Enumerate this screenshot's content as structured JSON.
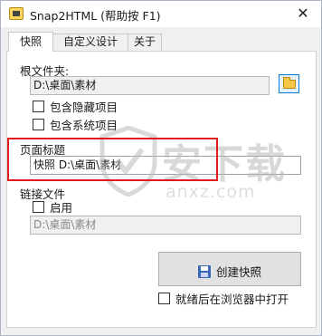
{
  "window": {
    "title": "Snap2HTML (帮助按 F1)",
    "close_glyph": "✕"
  },
  "tabs": [
    {
      "label": "快照",
      "active": true
    },
    {
      "label": "自定义设计",
      "active": false
    },
    {
      "label": "关于",
      "active": false
    }
  ],
  "root_folder": {
    "label": "根文件夹:",
    "value": "D:\\桌面\\素材",
    "browse_icon": "folder-icon"
  },
  "options": {
    "include_hidden": {
      "label": "包含隐藏项目",
      "checked": false
    },
    "include_system": {
      "label": "包含系统项目",
      "checked": false
    }
  },
  "page_title": {
    "label": "页面标题",
    "value": "快照 D:\\桌面\\素材"
  },
  "link_files": {
    "label": "链接文件",
    "enable": {
      "label": "启用",
      "checked": false
    },
    "value": "D:\\桌面\\素材"
  },
  "actions": {
    "create_snapshot_label": "创建快照",
    "create_snapshot_icon": "floppy-disk-icon",
    "open_after": {
      "label": "就绪后在浏览器中打开",
      "checked": false
    }
  },
  "watermark": {
    "text": "安下载",
    "domain": "anxz.com"
  },
  "colors": {
    "highlight": "#e11b1b",
    "folder_button_border": "#0a7bd6"
  }
}
